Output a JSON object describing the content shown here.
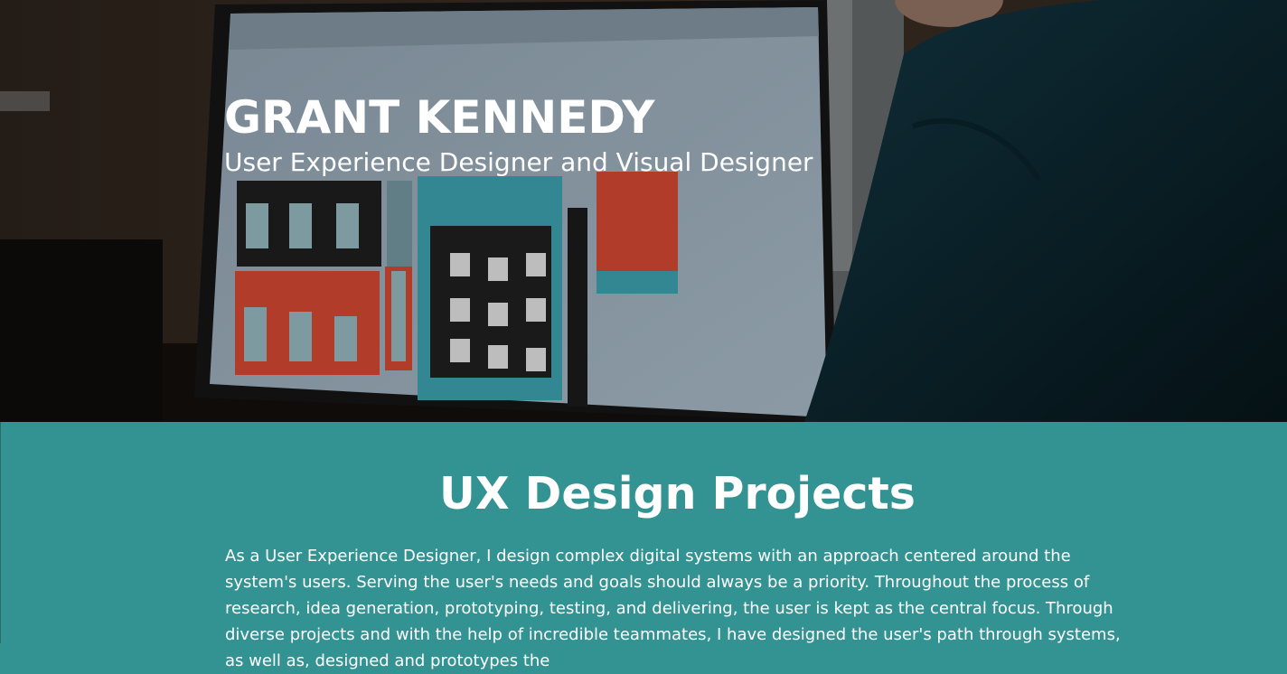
{
  "hero": {
    "name": "GRANT KENNEDY",
    "subtitle": "User Experience Designer and Visual Designer",
    "background_image": "person-at-monitor-photo"
  },
  "nav": {
    "menu_tab": "menu-tab"
  },
  "section": {
    "title": "UX Design Projects",
    "body": "As a User Experience Designer, I design complex digital systems with an approach centered around the system's users. Serving the user's needs and goals should always be a priority. Throughout the process of research, idea generation, prototyping, testing, and delivering, the user is kept as the central focus. Through diverse projects and with the help of incredible teammates, I have designed the user's path through systems, as well as, designed and prototypes the"
  },
  "colors": {
    "teal_section": "#339393",
    "text": "#ffffff"
  }
}
